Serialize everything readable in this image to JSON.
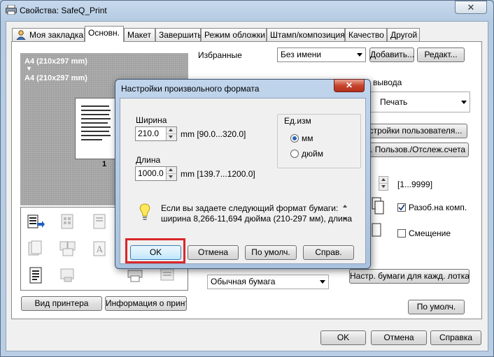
{
  "window": {
    "title": "Свойства: SafeQ_Print",
    "close": "✕"
  },
  "tabs": [
    {
      "label": "Моя закладка"
    },
    {
      "label": "Основн."
    },
    {
      "label": "Макет"
    },
    {
      "label": "Завершить"
    },
    {
      "label": "Режим обложки"
    },
    {
      "label": "Штамп/композиция"
    },
    {
      "label": "Качество"
    },
    {
      "label": "Другой"
    }
  ],
  "preview": {
    "size_line1": "A4 (210x297 mm)",
    "arrow": "▼",
    "size_line2": "A4 (210x297 mm)",
    "page_number": "1"
  },
  "left_buttons": {
    "printer_view": "Вид принтера",
    "printer_info": "Информация о принт."
  },
  "favorites": {
    "label": "Избранные",
    "value": "Без имени",
    "add": "Добавить...",
    "edit": "Редакт..."
  },
  "output": {
    "label_partial": "вывода",
    "value": "Печать"
  },
  "buttons_right": {
    "user_settings": "стройки пользователя...",
    "account": "т. Пользов./Отслеж.счета",
    "paper_per_tray": "Настр. бумаги для кажд. лотка...",
    "defaults": "По умолч."
  },
  "copies_range": "[1...9999]",
  "collate": {
    "label": "Разоб.на комп.",
    "checked": true
  },
  "offset": {
    "label": "Смещение",
    "checked": false
  },
  "paper_type": {
    "value": "Обычная бумага"
  },
  "footer": {
    "ok": "OK",
    "cancel": "Отмена",
    "help": "Справка"
  },
  "dialog": {
    "title": "Настройки произвольного формата",
    "close": "✕",
    "width": {
      "label": "Ширина",
      "value": "210.0",
      "unit_range": "mm [90.0...320.0]"
    },
    "length": {
      "label": "Длина",
      "value": "1000.0",
      "unit_range": "mm [139.7...1200.0]"
    },
    "units": {
      "label": "Ед.изм",
      "options": [
        {
          "label": "мм",
          "selected": true
        },
        {
          "label": "дюйм",
          "selected": false
        }
      ]
    },
    "info_text_line1": "Если вы задаете следующий формат бумаги:",
    "info_text_line2": "ширина 8,266-11,694 дюйма (210-297 мм), длина",
    "ok": "OK",
    "cancel": "Отмена",
    "defaults": "По умолч.",
    "help": "Справ.",
    "highlight_color": "#d9262a"
  }
}
